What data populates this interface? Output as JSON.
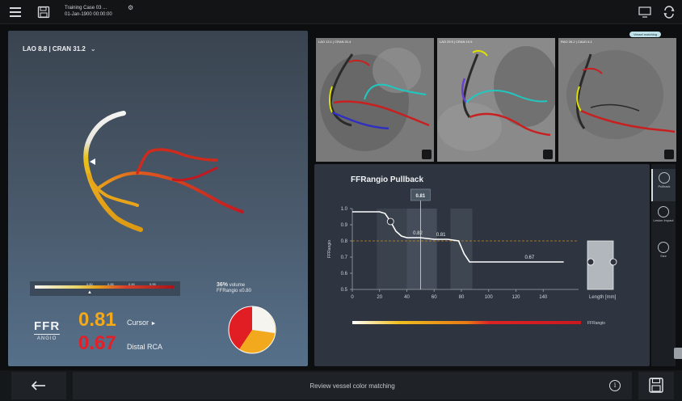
{
  "header": {
    "case_title": "Training Case 03 ...",
    "case_date": "01-Jan-1900 00:00:00"
  },
  "left_panel": {
    "view_label": "LAO 8.8 | CRAN 31.2",
    "scale_ticks": [
      "0.80",
      "0.85",
      "0.90",
      "0.95"
    ],
    "volume_percent": "36%",
    "volume_word": "volume",
    "volume_sub": "FFRangio ≤0.80",
    "ffr_logo_top": "FFR",
    "ffr_logo_bottom": "ANGIO",
    "cursor_value": "0.81",
    "cursor_label": "Cursor",
    "distal_value": "0.67",
    "distal_label": "Distal RCA",
    "pie_colors": {
      "red": "#e01e24",
      "orange": "#f2a91e",
      "white": "#f6f4ef"
    }
  },
  "angio_views": [
    {
      "label": "LAO 13.1 | CRAN 31.4"
    },
    {
      "label": "LAO 29.9 | CRAN 10.9"
    },
    {
      "label": "RAO 26.2 | CAUD 6.1"
    }
  ],
  "vessel_matching_label": "Vessel matching",
  "pullback": {
    "title": "FFRangio Pullback",
    "y_axis_label": "FFRangio",
    "x_axis_label": "Length [mm]",
    "cursor_badge": "0.81",
    "annotations": [
      "0.82",
      "0.81",
      "0.67"
    ],
    "legend_label": "FFRangio",
    "chart_data": {
      "type": "line",
      "x": [
        0,
        20,
        24,
        28,
        32,
        36,
        40,
        50,
        60,
        70,
        78,
        82,
        86,
        100,
        120,
        140,
        155
      ],
      "values": [
        0.98,
        0.98,
        0.97,
        0.92,
        0.86,
        0.83,
        0.82,
        0.82,
        0.81,
        0.81,
        0.8,
        0.72,
        0.67,
        0.67,
        0.67,
        0.67,
        0.67
      ],
      "xlim": [
        0,
        160
      ],
      "ylim": [
        0.5,
        1.0
      ],
      "x_ticks": [
        "0",
        "20",
        "40",
        "60",
        "80",
        "100",
        "120",
        "140"
      ],
      "y_ticks": [
        "1.0",
        "0.9",
        "0.8",
        "0.7",
        "0.6",
        "0.5"
      ],
      "threshold": 0.8,
      "cursor_x": 50,
      "xlabel": "Length [mm]",
      "ylabel": "FFRangio"
    }
  },
  "side_tabs": [
    {
      "label": "Pullback"
    },
    {
      "label": "Lesion Impact"
    },
    {
      "label": "Size"
    }
  ],
  "bottom": {
    "status": "Review vessel color matching",
    "info": "i"
  }
}
